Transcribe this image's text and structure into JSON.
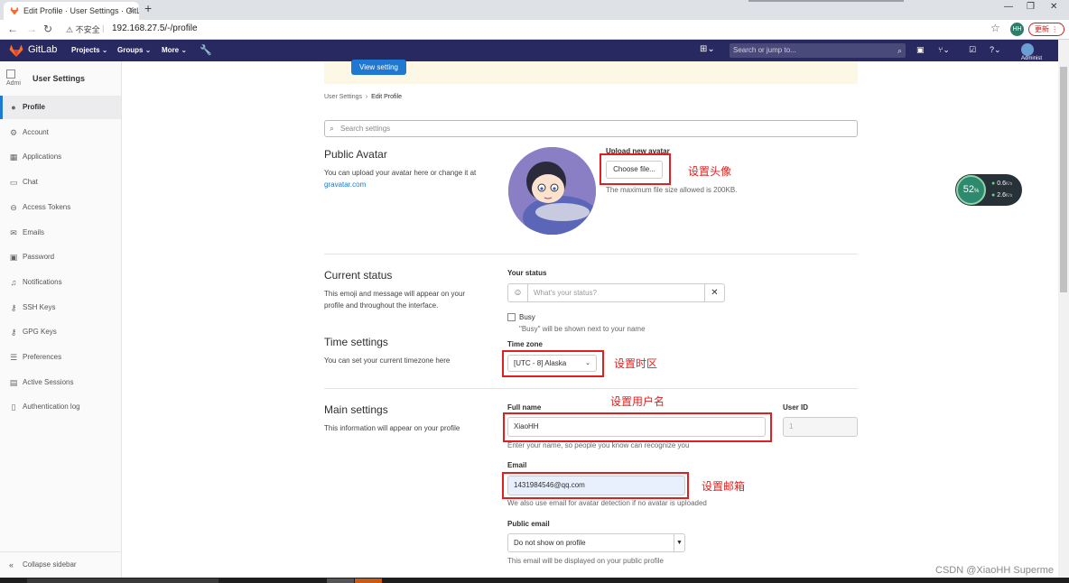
{
  "browser": {
    "tab_title": "Edit Profile · User Settings · GitLab",
    "tab_close": "×",
    "new_tab": "+",
    "insecure_label": "不安全",
    "url": "192.168.27.5/-/profile",
    "profile_initials": "HH",
    "update_label": "更新 ⋮"
  },
  "navbar": {
    "brand": "GitLab",
    "menus": [
      "Projects ⌄",
      "Groups ⌄",
      "More ⌄"
    ],
    "search_placeholder": "Search or jump to...",
    "user_label": "Administ"
  },
  "sidebar": {
    "avatar_alt": "Admi",
    "title": "User Settings",
    "items": [
      {
        "label": "Profile",
        "icon": "profile-icon",
        "glyph": "●"
      },
      {
        "label": "Account",
        "icon": "account-icon",
        "glyph": "⚙"
      },
      {
        "label": "Applications",
        "icon": "applications-icon",
        "glyph": "▦"
      },
      {
        "label": "Chat",
        "icon": "chat-icon",
        "glyph": "▭"
      },
      {
        "label": "Access Tokens",
        "icon": "token-icon",
        "glyph": "⊖"
      },
      {
        "label": "Emails",
        "icon": "email-icon",
        "glyph": "✉"
      },
      {
        "label": "Password",
        "icon": "lock-icon",
        "glyph": "▣"
      },
      {
        "label": "Notifications",
        "icon": "bell-icon",
        "glyph": "♫"
      },
      {
        "label": "SSH Keys",
        "icon": "key-icon",
        "glyph": "⚷"
      },
      {
        "label": "GPG Keys",
        "icon": "gpg-key-icon",
        "glyph": "⚷"
      },
      {
        "label": "Preferences",
        "icon": "preferences-icon",
        "glyph": "☰"
      },
      {
        "label": "Active Sessions",
        "icon": "sessions-icon",
        "glyph": "▤"
      },
      {
        "label": "Authentication log",
        "icon": "log-icon",
        "glyph": "▯"
      }
    ],
    "collapse_label": "Collapse sidebar"
  },
  "main": {
    "view_setting_button": "View setting",
    "breadcrumb": {
      "parent": "User Settings",
      "separator": "›",
      "current": "Edit Profile"
    },
    "search_placeholder": "Search settings",
    "public_avatar": {
      "heading": "Public Avatar",
      "desc": "You can upload your avatar here or change it at",
      "link": "gravatar.com",
      "upload_label": "Upload new avatar",
      "choose_file": "Choose file...",
      "max_size": "The maximum file size allowed is 200KB."
    },
    "current_status": {
      "heading": "Current status",
      "desc": "This emoji and message will appear on your profile and throughout the interface.",
      "your_status_label": "Your status",
      "status_placeholder": "What's your status?",
      "busy_label": "Busy",
      "busy_hint": "\"Busy\" will be shown next to your name"
    },
    "time_settings": {
      "heading": "Time settings",
      "desc": "You can set your current timezone here",
      "timezone_label": "Time zone",
      "timezone_value": "[UTC - 8] Alaska"
    },
    "main_settings": {
      "heading": "Main settings",
      "desc": "This information will appear on your profile",
      "full_name_label": "Full name",
      "full_name_value": "XiaoHH",
      "full_name_hint": "Enter your name, so people you know can recognize you",
      "user_id_label": "User ID",
      "user_id_value": "1",
      "email_label": "Email",
      "email_value": "1431984546@qq.com",
      "email_hint": "We also use email for avatar detection if no avatar is uploaded",
      "public_email_label": "Public email",
      "public_email_value": "Do not show on profile",
      "public_email_hint": "This email will be displayed on your public profile"
    }
  },
  "annotations": {
    "set_avatar": "设置头像",
    "set_timezone": "设置时区",
    "set_username": "设置用户名",
    "set_email": "设置邮箱"
  },
  "net_widget": {
    "percent": "52",
    "percent_unit": "%",
    "up": "0.6",
    "down": "2.6",
    "unit": "K/s"
  },
  "watermark": "CSDN @XiaoHH Superme",
  "colors": {
    "navbar_bg": "#292961",
    "primary": "#1f78d1",
    "annotation_red": "#e02020",
    "banner_bg": "#fdf7e6"
  }
}
